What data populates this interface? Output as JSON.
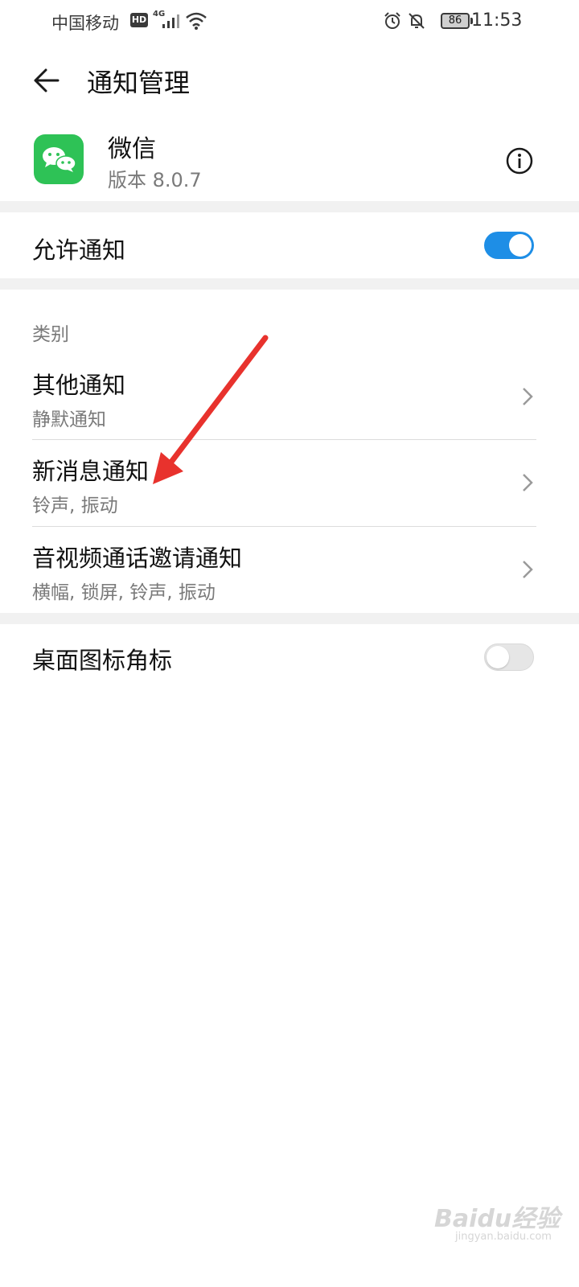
{
  "status_bar": {
    "carrier": "中国移动",
    "hd": "HD",
    "network": "4G",
    "battery": "86",
    "time": "11:53"
  },
  "header": {
    "title": "通知管理",
    "back_icon": "arrow-left-icon"
  },
  "app": {
    "name": "微信",
    "version": "版本 8.0.7",
    "info_icon": "info-icon",
    "icon_color": "#2ec256"
  },
  "allow_notifications": {
    "label": "允许通知",
    "enabled": true
  },
  "categories": {
    "label": "类别",
    "items": [
      {
        "title": "其他通知",
        "subtitle": "静默通知"
      },
      {
        "title": "新消息通知",
        "subtitle": "铃声, 振动"
      },
      {
        "title": "音视频通话邀请通知",
        "subtitle": "横幅, 锁屏, 铃声, 振动"
      }
    ]
  },
  "badge_setting": {
    "label": "桌面图标角标",
    "enabled": false
  },
  "annotation": {
    "color": "#e8322d"
  },
  "watermark": {
    "brand": "Baidu经验",
    "url": "jingyan.baidu.com"
  },
  "colors": {
    "toggle_on": "#1e8ee6",
    "section_gap": "#f1f1f1"
  }
}
